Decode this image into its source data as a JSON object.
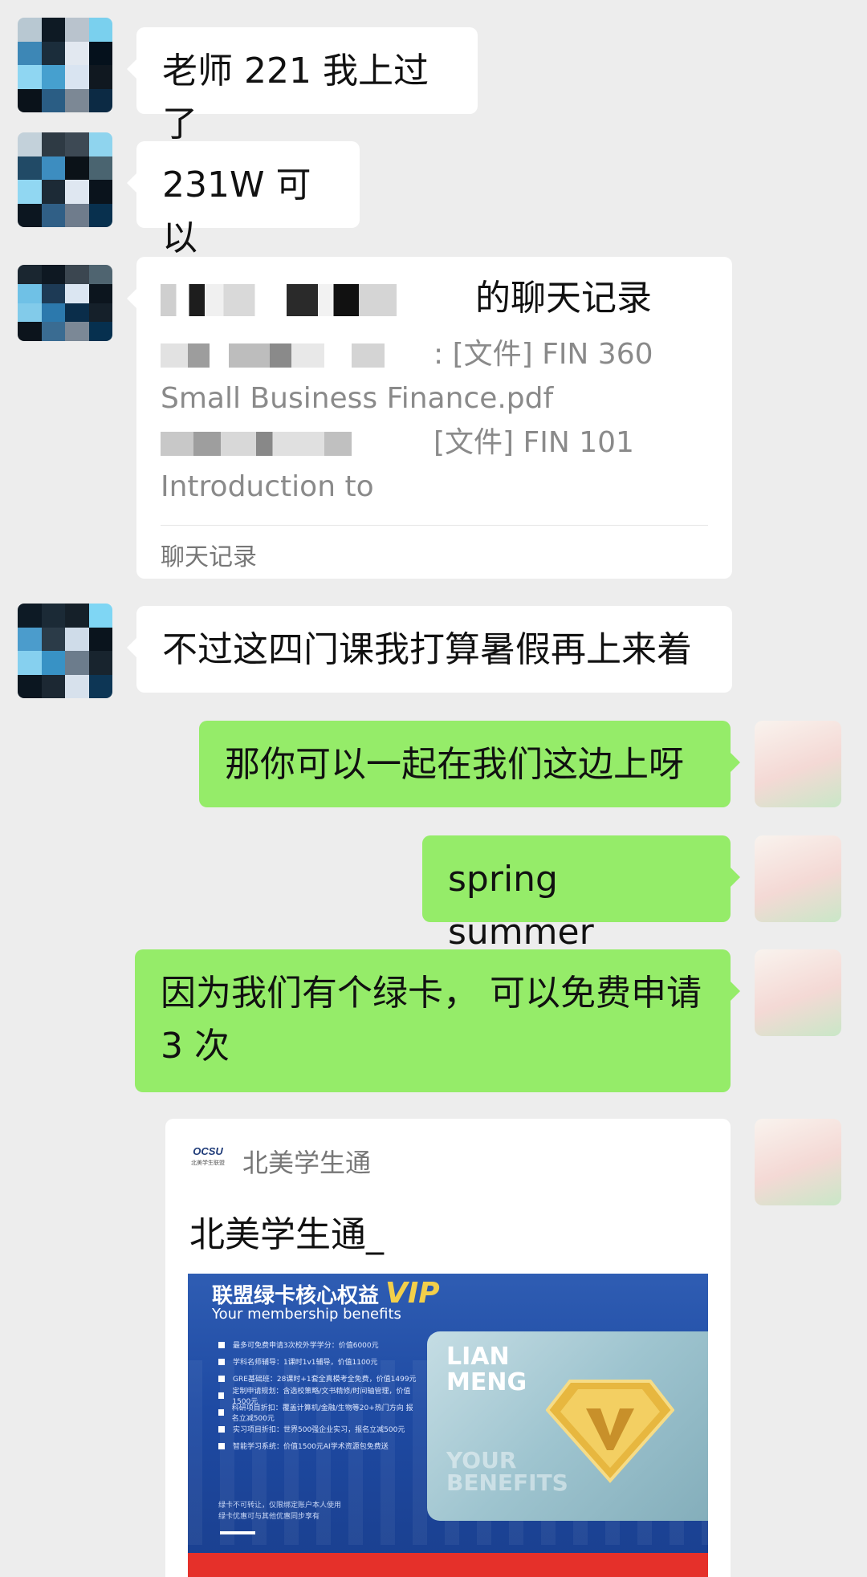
{
  "messages": {
    "m1": {
      "text": "老师 221 我上过了"
    },
    "m2": {
      "text": "231W 可以"
    },
    "chat_history": {
      "title_suffix": "的聊天记录",
      "line1": ": [文件] FIN 360",
      "line2": "Small Business Finance.pdf",
      "line3": "[文件] FIN 101",
      "line4": "Introduction to",
      "footer": "聊天记录"
    },
    "m3": {
      "text": "不过这四门课我打算暑假再上来着"
    },
    "m4": {
      "text": "那你可以一起在我们这边上呀"
    },
    "m5": {
      "text": "spring summer"
    },
    "m6": {
      "text": "因为我们有个绿卡， 可以免费申请 3 次"
    },
    "link_card": {
      "source_name": "北美学生通",
      "logo_text": "OCSU",
      "logo_subtext": "北美学生联盟",
      "title": "北美学生通_",
      "banner": {
        "heading": "联盟绿卡核心权益",
        "vip": "VIP",
        "subheading": "Your membership benefits",
        "benefits": [
          "最多可免费申请3次校外学学分：价值6000元",
          "学科名师辅导：1课时1v1辅导，价值1100元",
          "GRE基础班：28课时+1套全真模考全免费，价值1499元",
          "定制申请规划：含选校策略/文书精修/时间轴管理，价值1500元",
          "科研项目折扣：覆盖计算机/金融/生物等20+热门方向 报名立减500元",
          "实习项目折扣：世界500强企业实习，报名立减500元",
          "智能学习系统：价值1500元AI学术资源包免费送"
        ],
        "notes": [
          "绿卡不可转让，仅限绑定账户本人使用",
          "绿卡优惠可与其他优惠同步享有"
        ],
        "card_word1": "LIAN",
        "card_word2": "MENG",
        "card_word3": "YOUR",
        "card_word4": "BENEFITS"
      }
    }
  },
  "colors": {
    "background": "#ededed",
    "bubble_self": "#95ec69",
    "bubble_other": "#ffffff",
    "secondary_text": "#8a8a8a"
  }
}
